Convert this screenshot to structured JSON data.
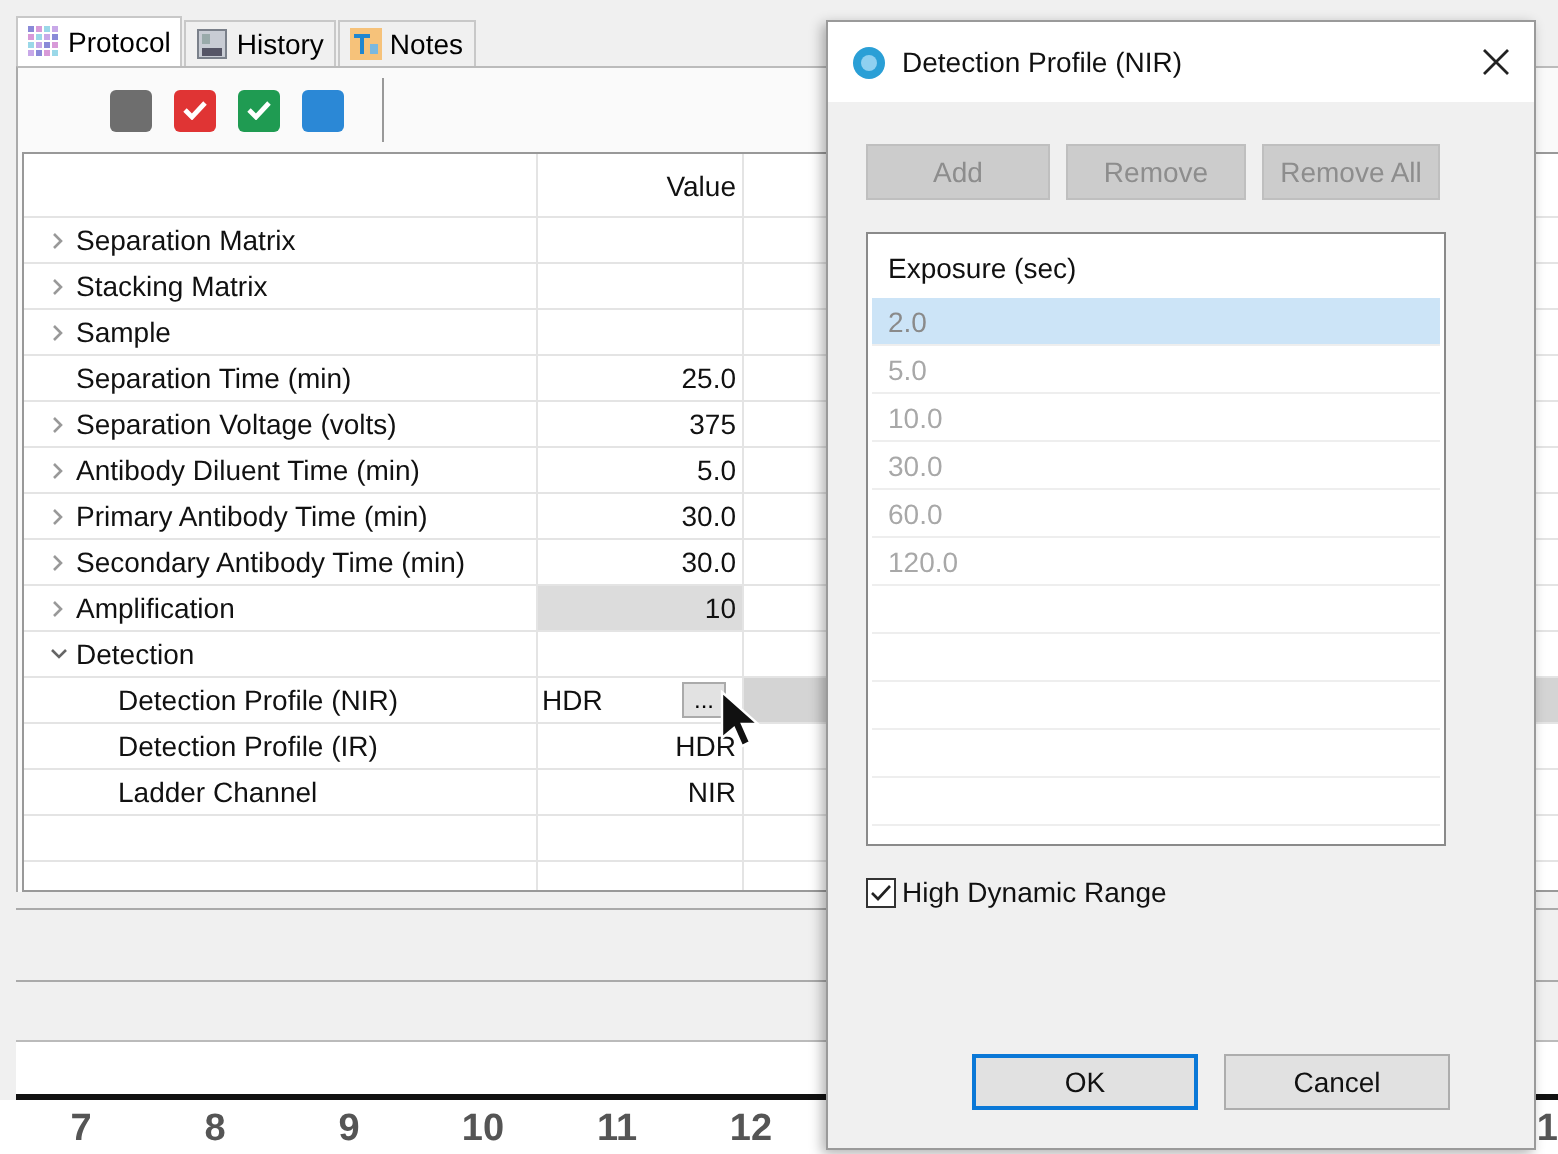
{
  "tabs": [
    {
      "label": "Protocol",
      "selected": true
    },
    {
      "label": "History",
      "selected": false
    },
    {
      "label": "Notes",
      "selected": false
    }
  ],
  "toolbar": [
    {
      "color": "#6e6e6e",
      "checked": false
    },
    {
      "color": "#e03434",
      "checked": true
    },
    {
      "color": "#1f9b52",
      "checked": true
    },
    {
      "color": "#2b88d6",
      "checked": false
    }
  ],
  "grid": {
    "value_header": "Value",
    "rows": [
      {
        "label": "Separation Matrix",
        "expandable": true,
        "expanded": false,
        "selected": false,
        "highlighted": false
      },
      {
        "label": "Stacking Matrix",
        "expandable": true,
        "expanded": false,
        "selected": false,
        "highlighted": false
      },
      {
        "label": "Sample",
        "expandable": true,
        "expanded": false,
        "selected": false,
        "highlighted": false
      },
      {
        "label": "Separation Time (min)",
        "value": "25.0",
        "expandable": false,
        "expanded": false,
        "selected": false,
        "highlighted": false
      },
      {
        "label": "Separation Voltage (volts)",
        "value": "375",
        "expandable": true,
        "expanded": false,
        "selected": false,
        "highlighted": false
      },
      {
        "label": "Antibody Diluent Time (min)",
        "value": "5.0",
        "expandable": true,
        "expanded": false,
        "selected": false,
        "highlighted": false
      },
      {
        "label": "Primary Antibody Time (min)",
        "value": "30.0",
        "expandable": true,
        "expanded": false,
        "selected": false,
        "highlighted": false
      },
      {
        "label": "Secondary Antibody Time (min)",
        "value": "30.0",
        "expandable": true,
        "expanded": false,
        "selected": false,
        "highlighted": false
      },
      {
        "label": "Amplification",
        "value": "10",
        "expandable": true,
        "expanded": false,
        "selected": false,
        "highlighted": true
      },
      {
        "label": "Detection",
        "expandable": true,
        "expanded": true,
        "selected": false,
        "highlighted": false,
        "children": [
          {
            "label": "Detection Profile (NIR)",
            "value": "HDR",
            "editor_button": "...",
            "expandable": false,
            "expanded": false,
            "selected": true,
            "highlighted": false
          },
          {
            "label": "Detection Profile (IR)",
            "value": "HDR",
            "expandable": false,
            "expanded": false,
            "selected": false,
            "highlighted": false
          },
          {
            "label": "Ladder Channel",
            "value": "NIR",
            "expandable": false,
            "expanded": false,
            "selected": false,
            "highlighted": false
          }
        ]
      }
    ]
  },
  "axis_labels": [
    "7",
    "8",
    "9",
    "10",
    "11",
    "12"
  ],
  "axis_label_cut": "1",
  "dialog": {
    "title": "Detection Profile (NIR)",
    "buttons": [
      {
        "label": "Add",
        "disabled": true
      },
      {
        "label": "Remove",
        "disabled": true
      },
      {
        "label": "Remove All",
        "disabled": true
      }
    ],
    "list": {
      "header": "Exposure (sec)",
      "disabled": true,
      "items": [
        {
          "label": "2.0",
          "selected": true
        },
        {
          "label": "5.0",
          "selected": false
        },
        {
          "label": "10.0",
          "selected": false
        },
        {
          "label": "30.0",
          "selected": false
        },
        {
          "label": "60.0",
          "selected": false
        },
        {
          "label": "120.0",
          "selected": false
        }
      ]
    },
    "checkbox": {
      "label": "High Dynamic Range",
      "checked": true
    },
    "actions": [
      {
        "label": "OK",
        "default": true
      },
      {
        "label": "Cancel",
        "default": false
      }
    ]
  }
}
